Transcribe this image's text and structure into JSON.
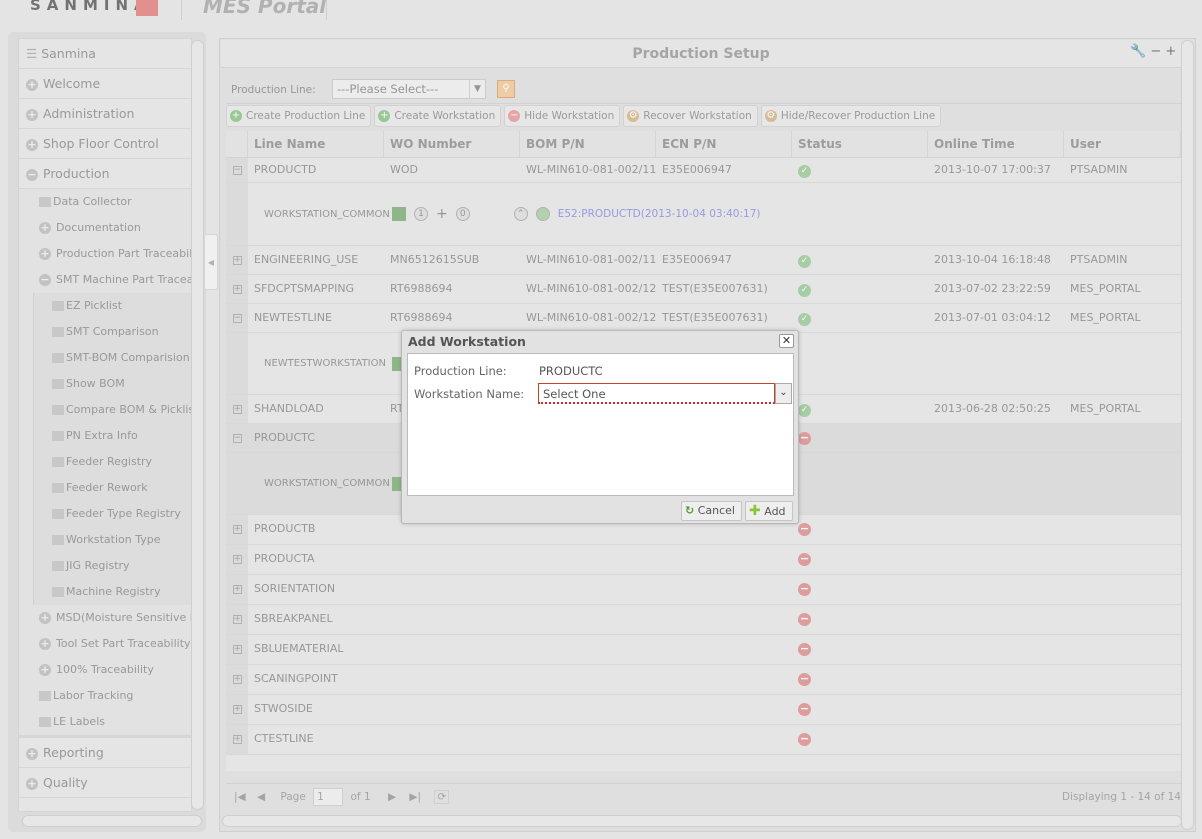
{
  "header": {
    "logo_text": "SANMINA",
    "portal_title": "MES Portal"
  },
  "sidebar": {
    "title": "Sanmina",
    "top_items": [
      {
        "label": "Welcome"
      },
      {
        "label": "Administration"
      },
      {
        "label": "Shop Floor Control"
      }
    ],
    "production": {
      "label": "Production",
      "children": [
        {
          "label": "Data Collector",
          "icon": "folder"
        },
        {
          "label": "Documentation",
          "icon": "plus"
        },
        {
          "label": "Production Part Traceability",
          "icon": "plus"
        },
        {
          "label": "SMT Machine Part Traceability",
          "icon": "minus",
          "children": [
            "EZ Picklist",
            "SMT Comparison",
            "SMT-BOM Comparision",
            "Show BOM",
            "Compare BOM & Picklist",
            "PN Extra Info",
            "Feeder Registry",
            "Feeder Rework",
            "Feeder Type Registry",
            "Workstation Type",
            "JIG Registry",
            "Machine Registry"
          ]
        },
        {
          "label": "MSD(Moisture Sensitive Device)",
          "icon": "plus"
        },
        {
          "label": "Tool Set Part Traceability",
          "icon": "plus"
        },
        {
          "label": "100% Traceability",
          "icon": "plus"
        },
        {
          "label": "Labor Tracking",
          "icon": "folder"
        },
        {
          "label": "LE Labels",
          "icon": "folder"
        }
      ]
    },
    "bottom_items": [
      {
        "label": "Reporting"
      },
      {
        "label": "Quality"
      }
    ]
  },
  "main": {
    "title": "Production Setup",
    "production_line_label": "Production Line:",
    "production_line_value": "---Please Select---",
    "toolbar": [
      "Create Production Line",
      "Create Workstation",
      "Hide Workstation",
      "Recover Workstation",
      "Hide/Recover Production Line"
    ],
    "columns": [
      "Line Name",
      "WO Number",
      "BOM P/N",
      "ECN P/N",
      "Status",
      "Online Time",
      "User"
    ],
    "rows": [
      {
        "line": "PRODUCTD",
        "wo": "WOD",
        "bom": "WL-MIN610-081-002/11",
        "ecn": "E35E006947",
        "status": "ok",
        "time": "2013-10-07 17:00:37",
        "user": "PTSADMIN",
        "expanded": true,
        "detail": {
          "ws": "WORKSTATION_COMMON",
          "count1": "1",
          "count2": "0",
          "link": "E52:PRODUCTD(2013-10-04 03:40:17)"
        }
      },
      {
        "line": "ENGINEERING_USE",
        "wo": "MN6512615SUB",
        "bom": "WL-MIN610-081-002/11",
        "ecn": "E35E006947",
        "status": "ok",
        "time": "2013-10-04 16:18:48",
        "user": "PTSADMIN"
      },
      {
        "line": "SFDCPTSMAPPING",
        "wo": "RT6988694",
        "bom": "WL-MIN610-081-002/12",
        "ecn": "TEST(E35E007631)",
        "status": "ok",
        "time": "2013-07-02 23:22:59",
        "user": "MES_PORTAL"
      },
      {
        "line": "NEWTESTLINE",
        "wo": "RT6988694",
        "bom": "WL-MIN610-081-002/12",
        "ecn": "TEST(E35E007631)",
        "status": "ok",
        "time": "2013-07-01 03:04:12",
        "user": "MES_PORTAL",
        "expanded": true,
        "detail": {
          "ws": "NEWTESTWORKSTATION"
        }
      },
      {
        "line": "SHANDLOAD",
        "wo": "RT",
        "bom": "",
        "ecn": "",
        "status": "ok",
        "time": "2013-06-28 02:50:25",
        "user": "MES_PORTAL"
      },
      {
        "line": "PRODUCTC",
        "wo": "",
        "bom": "",
        "ecn": "",
        "status": "error",
        "time": "",
        "user": "",
        "expanded": true,
        "selected": true,
        "detail": {
          "ws": "WORKSTATION_COMMON"
        }
      },
      {
        "line": "PRODUCTB",
        "status": "error"
      },
      {
        "line": "PRODUCTA",
        "status": "error"
      },
      {
        "line": "SORIENTATION",
        "status": "error"
      },
      {
        "line": "SBREAKPANEL",
        "status": "error"
      },
      {
        "line": "SBLUEMATERIAL",
        "status": "error"
      },
      {
        "line": "SCANINGPOINT",
        "status": "error"
      },
      {
        "line": "STWOSIDE",
        "status": "error"
      },
      {
        "line": "CTESTLINE",
        "status": "error"
      }
    ],
    "pager": {
      "page_label": "Page",
      "page": "1",
      "of": "of 1",
      "display": "Displaying 1 - 14 of 14"
    }
  },
  "dialog": {
    "title": "Add Workstation",
    "production_line_label": "Production Line:",
    "production_line_value": "PRODUCTC",
    "workstation_label": "Workstation Name:",
    "workstation_value": "Select One",
    "cancel": "Cancel",
    "add": "Add"
  },
  "colors": {
    "ok": "#9cc99a",
    "error": "#dd9191",
    "link": "#8a8ee0",
    "invalid_border": "#c0462a"
  }
}
